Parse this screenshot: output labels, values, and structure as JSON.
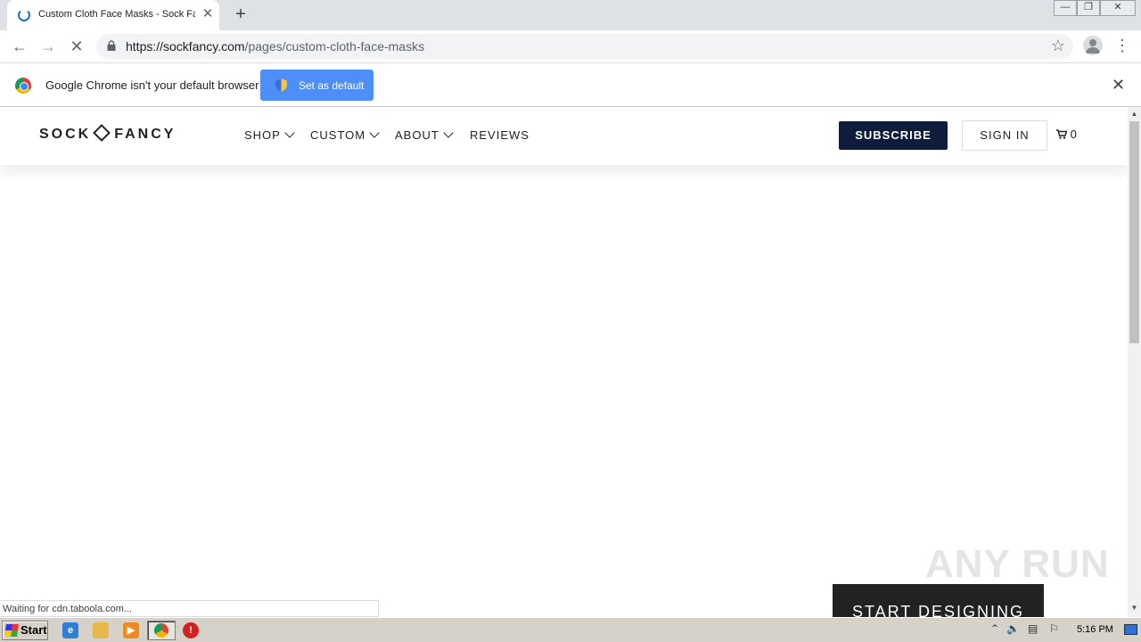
{
  "browser": {
    "tab": {
      "title": "Custom Cloth Face Masks - Sock Fancy",
      "close": "✕"
    },
    "new_tab": "+",
    "window_controls": {
      "minimize": "—",
      "restore": "❐",
      "close": "✕"
    },
    "url_host": "https://sockfancy.com",
    "url_path": "/pages/custom-cloth-face-masks"
  },
  "infobar": {
    "message": "Google Chrome isn't your default browser",
    "button": "Set as default",
    "close": "✕"
  },
  "site": {
    "logo_left": "SOCK",
    "logo_right": "FANCY",
    "nav": [
      {
        "label": "SHOP"
      },
      {
        "label": "CUSTOM"
      },
      {
        "label": "ABOUT"
      },
      {
        "label": "REVIEWS"
      }
    ],
    "subscribe": "SUBSCRIBE",
    "sign_in": "SIGN IN",
    "cart_count": "0",
    "cta": "START DESIGNING"
  },
  "watermark": "ANY RUN",
  "status_text": "Waiting for cdn.taboola.com...",
  "taskbar": {
    "start": "Start",
    "clock": "5:16 PM"
  },
  "colors": {
    "subscribe_bg": "#0f1c3c",
    "infobar_button": "#4d8ef8",
    "chrome_blue": "#1a73e8"
  }
}
